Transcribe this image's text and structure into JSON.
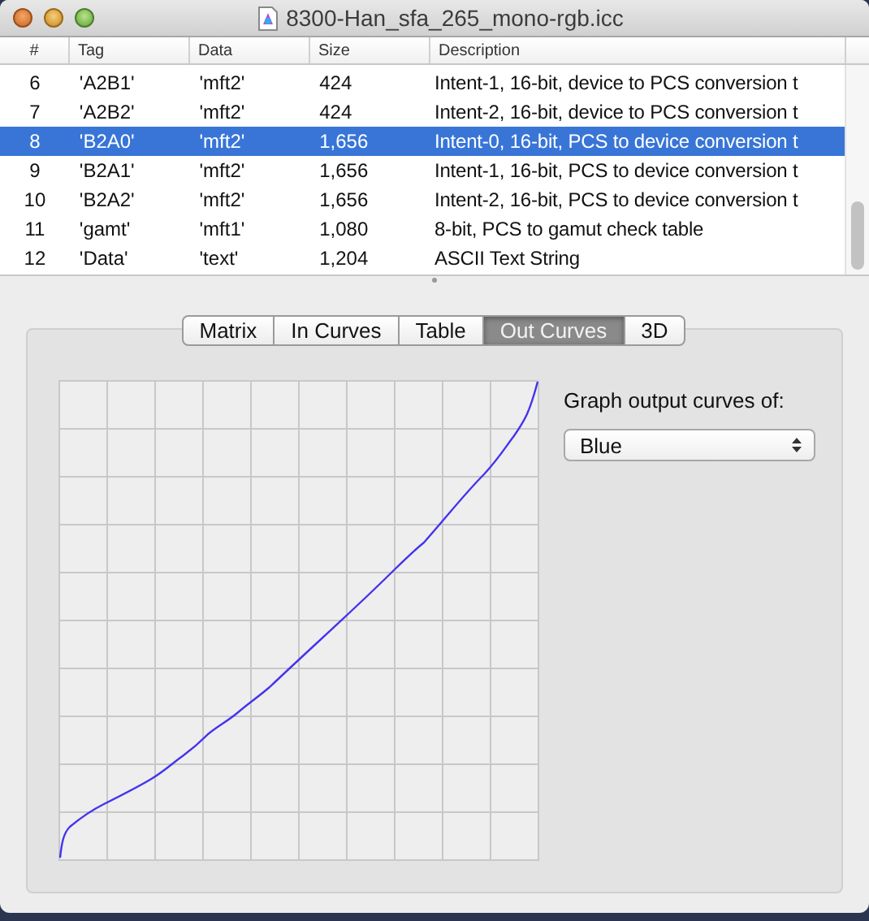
{
  "window": {
    "title": "8300-Han_sfa_265_mono-rgb.icc"
  },
  "table": {
    "columns": [
      "#",
      "Tag",
      "Data",
      "Size",
      "Description"
    ],
    "rows": [
      {
        "cells": [
          "6",
          "'A2B1'",
          "'mft2'",
          "424",
          "Intent-1, 16-bit, device to PCS conversion t"
        ],
        "selected": false
      },
      {
        "cells": [
          "7",
          "'A2B2'",
          "'mft2'",
          "424",
          "Intent-2, 16-bit, device to PCS conversion t"
        ],
        "selected": false
      },
      {
        "cells": [
          "8",
          "'B2A0'",
          "'mft2'",
          "1,656",
          "Intent-0, 16-bit, PCS to device conversion t"
        ],
        "selected": true
      },
      {
        "cells": [
          "9",
          "'B2A1'",
          "'mft2'",
          "1,656",
          "Intent-1, 16-bit, PCS to device conversion t"
        ],
        "selected": false
      },
      {
        "cells": [
          "10",
          "'B2A2'",
          "'mft2'",
          "1,656",
          "Intent-2, 16-bit, PCS to device conversion t"
        ],
        "selected": false
      },
      {
        "cells": [
          "11",
          "'gamt'",
          "'mft1'",
          "1,080",
          "8-bit, PCS to gamut check table"
        ],
        "selected": false
      },
      {
        "cells": [
          "12",
          "'Data'",
          "'text'",
          "1,204",
          "ASCII Text String"
        ],
        "selected": false
      }
    ]
  },
  "tabs": [
    {
      "label": "Matrix",
      "selected": false
    },
    {
      "label": "In Curves",
      "selected": false
    },
    {
      "label": "Table",
      "selected": false
    },
    {
      "label": "Out Curves",
      "selected": true
    },
    {
      "label": "3D",
      "selected": false
    }
  ],
  "curve_panel": {
    "label": "Graph output curves of:",
    "popup": {
      "value": "Blue"
    }
  }
}
